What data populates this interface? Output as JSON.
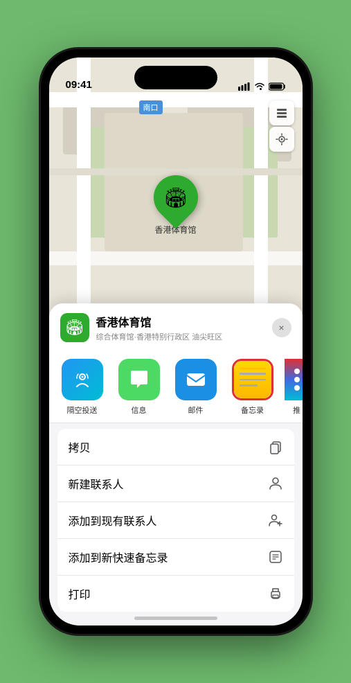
{
  "status": {
    "time": "09:41",
    "location_arrow": "▶"
  },
  "map": {
    "label": "南口",
    "pin_name": "香港体育馆",
    "pin_emoji": "🏟"
  },
  "place_header": {
    "name": "香港体育馆",
    "subtitle": "综合体育馆·香港特别行政区 油尖旺区",
    "close_label": "×"
  },
  "share_actions": [
    {
      "id": "airdrop",
      "label": "隔空投送",
      "type": "airdrop"
    },
    {
      "id": "message",
      "label": "信息",
      "type": "message"
    },
    {
      "id": "mail",
      "label": "邮件",
      "type": "mail"
    },
    {
      "id": "notes",
      "label": "备忘录",
      "type": "notes"
    },
    {
      "id": "more",
      "label": "推",
      "type": "more"
    }
  ],
  "menu_items": [
    {
      "label": "拷贝",
      "icon": "copy"
    },
    {
      "label": "新建联系人",
      "icon": "person"
    },
    {
      "label": "添加到现有联系人",
      "icon": "person-add"
    },
    {
      "label": "添加到新快速备忘录",
      "icon": "note"
    },
    {
      "label": "打印",
      "icon": "print"
    }
  ]
}
